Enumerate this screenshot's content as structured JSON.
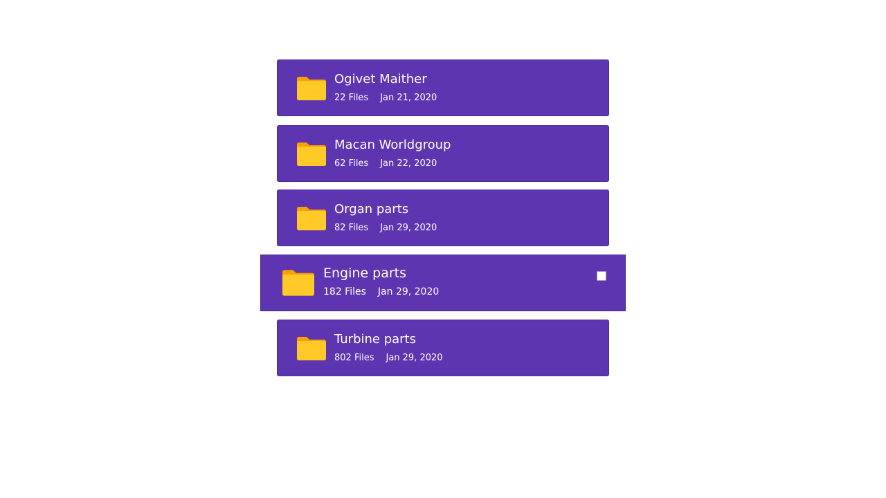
{
  "colors": {
    "card_background": "#5e35b1",
    "folder_front": "#ffca28",
    "folder_back": "#ffa000",
    "text": "#ffffff"
  },
  "folders": [
    {
      "name": "Ogivet Maither",
      "files": "22 Files",
      "date": "Jan 21, 2020",
      "icon": "folder-icon",
      "hovered": false
    },
    {
      "name": "Macan Worldgroup",
      "files": "62 Files",
      "date": "Jan 22, 2020",
      "icon": "folder-icon",
      "hovered": false
    },
    {
      "name": "Organ parts",
      "files": "82 Files",
      "date": "Jan 29, 2020",
      "icon": "folder-icon",
      "hovered": false
    },
    {
      "name": "Engine parts",
      "files": "182 Files",
      "date": "Jan 29, 2020",
      "icon": "folder-icon",
      "hovered": true,
      "checked": false
    },
    {
      "name": "Turbine parts",
      "files": "802 Files",
      "date": "Jan 29, 2020",
      "icon": "folder-icon",
      "hovered": false
    }
  ]
}
